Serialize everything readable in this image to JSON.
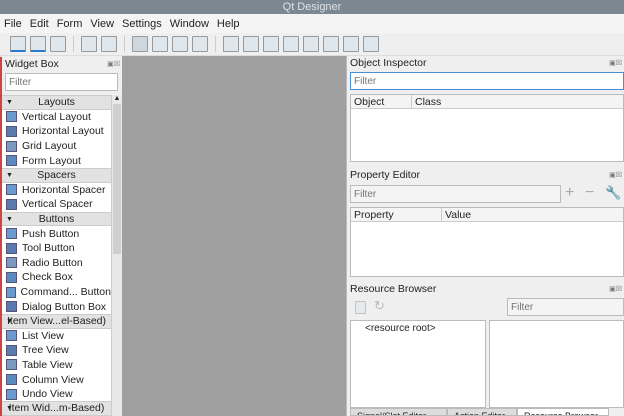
{
  "window": {
    "title": "Qt Designer"
  },
  "menu": [
    "File",
    "Edit",
    "Form",
    "View",
    "Settings",
    "Window",
    "Help"
  ],
  "toolbar": [
    "new-form",
    "open-form",
    "save-form",
    "bring-to-front",
    "send-to-back",
    "edit-widgets",
    "edit-signals-slots",
    "edit-buddies",
    "edit-tab-order",
    "layout-horizontally",
    "layout-vertically",
    "layout-horizontal-splitter",
    "layout-vertical-splitter",
    "layout-grid",
    "layout-form",
    "break-layout",
    "adjust-size"
  ],
  "widget_box": {
    "title": "Widget Box",
    "filter_placeholder": "Filter",
    "categories": [
      {
        "label": "Layouts",
        "items": [
          "Vertical Layout",
          "Horizontal Layout",
          "Grid Layout",
          "Form Layout"
        ]
      },
      {
        "label": "Spacers",
        "items": [
          "Horizontal Spacer",
          "Vertical Spacer"
        ]
      },
      {
        "label": "Buttons",
        "items": [
          "Push Button",
          "Tool Button",
          "Radio Button",
          "Check Box",
          "Command... Button",
          "Dialog Button Box"
        ]
      },
      {
        "label": "Item View...el-Based)",
        "items": [
          "List View",
          "Tree View",
          "Table View",
          "Column View",
          "Undo View"
        ]
      },
      {
        "label": "Item Wid...m-Based)",
        "items": []
      }
    ]
  },
  "object_inspector": {
    "title": "Object Inspector",
    "filter_placeholder": "Filter",
    "columns": [
      "Object",
      "Class"
    ]
  },
  "property_editor": {
    "title": "Property Editor",
    "filter_placeholder": "Filter",
    "columns": [
      "Property",
      "Value"
    ]
  },
  "resource_browser": {
    "title": "Resource Browser",
    "filter_placeholder": "Filter",
    "root": "<resource root>"
  },
  "bottom_tabs": [
    "Signal/Slot Editor",
    "Action Editor",
    "Resource Browser"
  ]
}
